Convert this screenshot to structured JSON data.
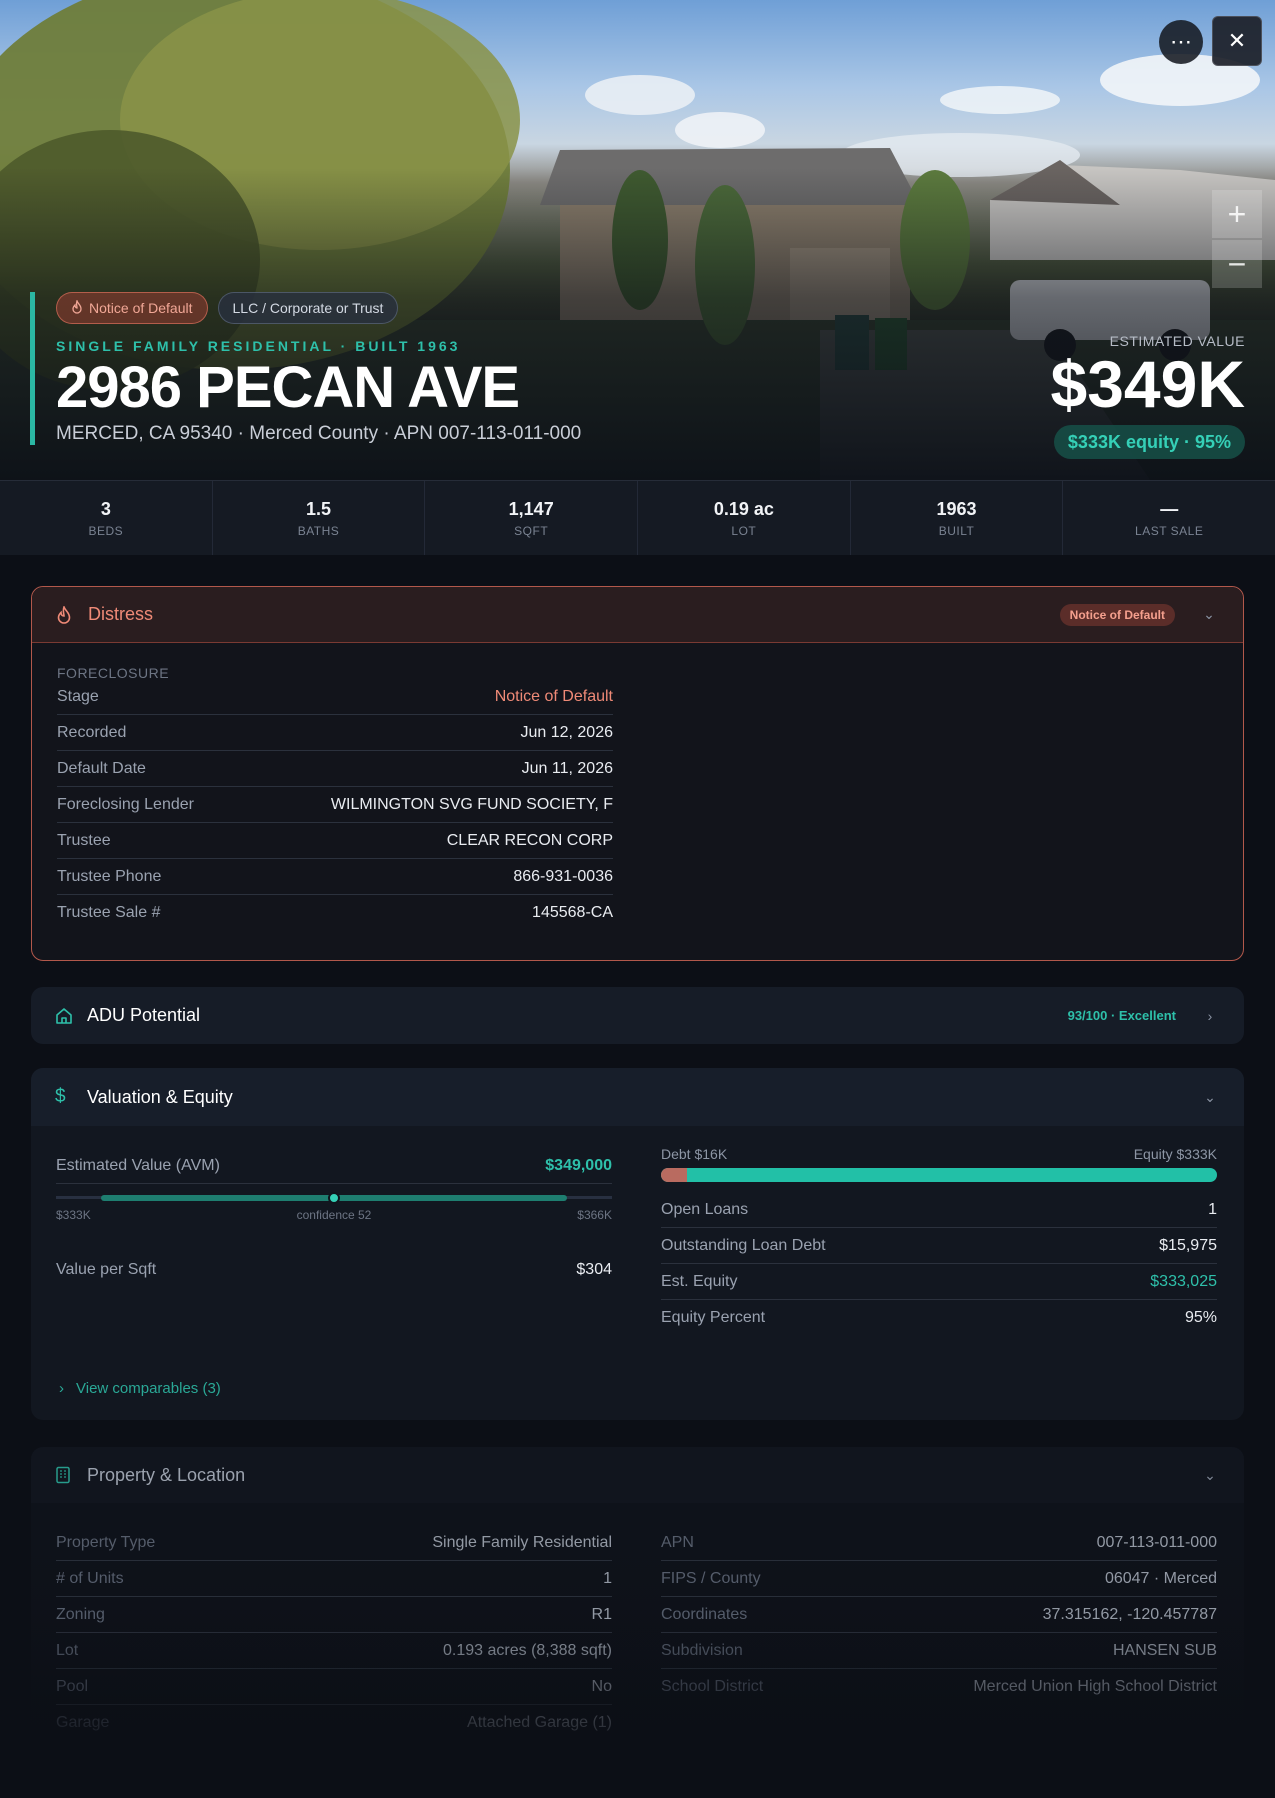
{
  "hero": {
    "badges": {
      "nod": "Notice of Default",
      "owner": "LLC / Corporate or Trust"
    },
    "eyebrow": "SINGLE FAMILY RESIDENTIAL · BUILT 1963",
    "address": "2986 PECAN AVE",
    "subline": "MERCED, CA 95340 · Merced County · APN 007-113-011-000",
    "est_label": "ESTIMATED VALUE",
    "est_value": "$349K",
    "equity_pill": "$333K equity · 95%",
    "zoom_in": "+",
    "zoom_out": "−"
  },
  "stats": [
    {
      "value": "3",
      "label": "BEDS"
    },
    {
      "value": "1.5",
      "label": "BATHS"
    },
    {
      "value": "1,147",
      "label": "SQFT"
    },
    {
      "value": "0.19 ac",
      "label": "LOT"
    },
    {
      "value": "1963",
      "label": "BUILT"
    },
    {
      "value": "—",
      "label": "LAST SALE"
    }
  ],
  "distress": {
    "title": "Distress",
    "pill": "Notice of Default",
    "section": "FORECLOSURE",
    "rows": [
      {
        "k": "Stage",
        "v": "Notice of Default"
      },
      {
        "k": "Recorded",
        "v": "Jun 12, 2026"
      },
      {
        "k": "Default Date",
        "v": "Jun 11, 2026"
      },
      {
        "k": "Foreclosing Lender",
        "v": "WILMINGTON SVG FUND SOCIETY, F"
      },
      {
        "k": "Trustee",
        "v": "CLEAR RECON CORP"
      },
      {
        "k": "Trustee Phone",
        "v": "866-931-0036"
      },
      {
        "k": "Trustee Sale #",
        "v": "145568-CA"
      }
    ]
  },
  "adu": {
    "title": "ADU Potential",
    "score": "93/100 · Excellent"
  },
  "valuation": {
    "title": "Valuation & Equity",
    "avm_label": "Estimated Value (AVM)",
    "avm_value": "$349,000",
    "range_low": "$333K",
    "confidence": "confidence 52",
    "range_high": "$366K",
    "vps_label": "Value per Sqft",
    "vps_value": "$304",
    "debt_label": "Debt $16K",
    "equity_label": "Equity $333K",
    "debt_fraction": 0.046,
    "rows": [
      {
        "k": "Open Loans",
        "v": "1"
      },
      {
        "k": "Outstanding Loan Debt",
        "v": "$15,975"
      },
      {
        "k": "Est. Equity",
        "v": "$333,025"
      },
      {
        "k": "Equity Percent",
        "v": "95%"
      }
    ],
    "comps_link": "View comparables (3)"
  },
  "property": {
    "title": "Property & Location",
    "left": [
      {
        "k": "Property Type",
        "v": "Single Family Residential"
      },
      {
        "k": "# of Units",
        "v": "1"
      },
      {
        "k": "Zoning",
        "v": "R1"
      },
      {
        "k": "Lot",
        "v": "0.193 acres (8,388 sqft)"
      },
      {
        "k": "Pool",
        "v": "No"
      },
      {
        "k": "Garage",
        "v": "Attached Garage (1)"
      }
    ],
    "right": [
      {
        "k": "APN",
        "v": "007-113-011-000"
      },
      {
        "k": "FIPS / County",
        "v": "06047 · Merced"
      },
      {
        "k": "Coordinates",
        "v": "37.315162, -120.457787"
      },
      {
        "k": "Subdivision",
        "v": "HANSEN SUB"
      },
      {
        "k": "School District",
        "v": "Merced Union High School District"
      }
    ]
  },
  "colors": {
    "accent": "#2bb7a3",
    "danger": "#ef8a77",
    "background": "#0c0f16"
  }
}
